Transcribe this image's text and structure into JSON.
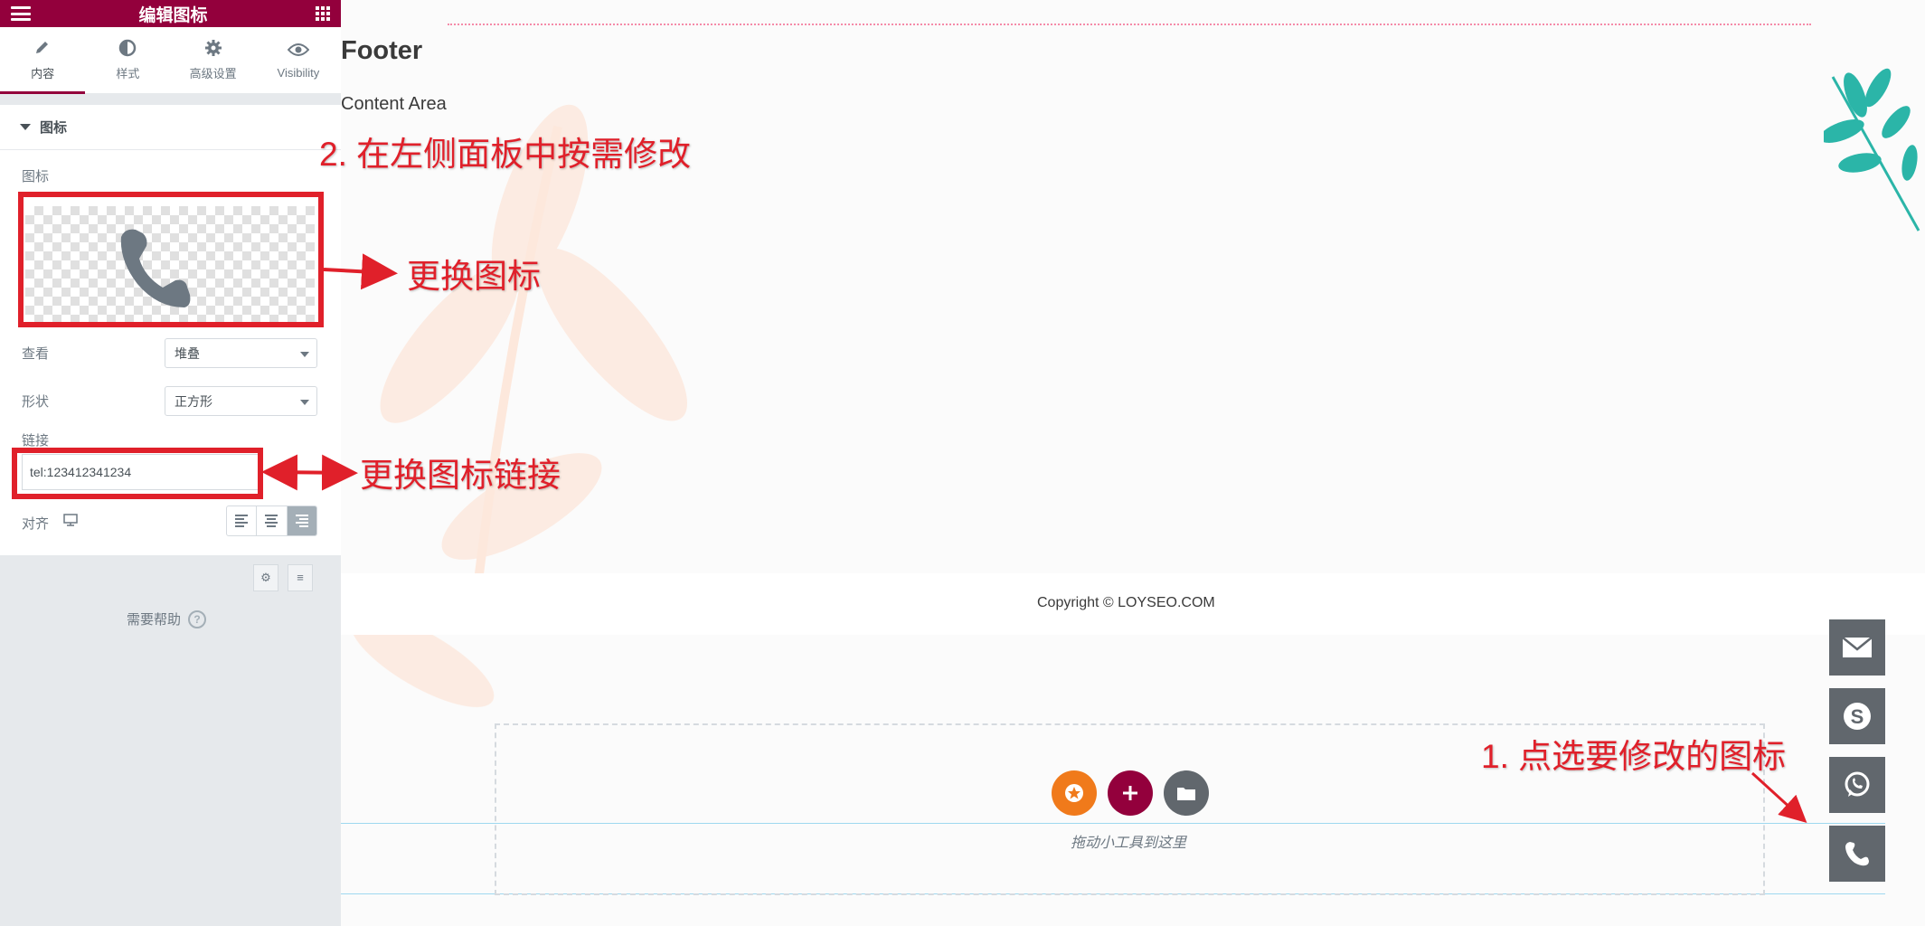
{
  "panel": {
    "title": "编辑图标",
    "tabs": [
      {
        "label": "内容",
        "icon": "pencil-icon"
      },
      {
        "label": "样式",
        "icon": "half-circle-icon"
      },
      {
        "label": "高级设置",
        "icon": "gear-icon"
      },
      {
        "label": "Visibility",
        "icon": "eye-icon"
      }
    ],
    "section_title": "图标",
    "icon_label": "图标",
    "view_label": "查看",
    "view_value": "堆叠",
    "shape_label": "形状",
    "shape_value": "正方形",
    "link_label": "链接",
    "link_value": "tel:123412341234",
    "align_label": "对齐",
    "help_label": "需要帮助",
    "help_glyph": "?"
  },
  "preview": {
    "footer_title": "Footer",
    "content_area": "Content Area",
    "copyright": "Copyright © LOYSEO.COM",
    "drag_hint": "拖动小工具到这里",
    "floating_icons": [
      "mail-icon",
      "skype-icon",
      "whatsapp-icon",
      "phone-icon"
    ],
    "circle_buttons": [
      {
        "icon": "star-icon",
        "color": "#f07a1b"
      },
      {
        "icon": "plus-icon",
        "color": "#93003c"
      },
      {
        "icon": "folder-icon",
        "color": "#61676d"
      }
    ]
  },
  "annotations": {
    "step2": "2. 在左侧面板中按需修改",
    "change_icon": "更换图标",
    "change_link": "更换图标链接",
    "step1": "1. 点选要修改的图标"
  },
  "colors": {
    "brand": "#93003c",
    "annotation_red": "#e0202a",
    "icon_gray": "#61676d",
    "leaf_teal": "#2bb5a8"
  }
}
